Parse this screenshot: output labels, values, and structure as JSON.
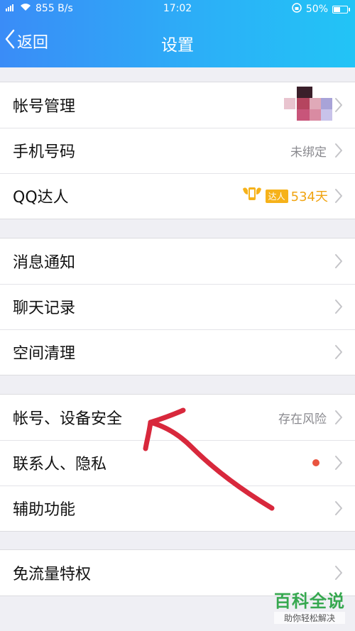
{
  "status_bar": {
    "network": "855 B/s",
    "time": "17:02",
    "battery": "50%",
    "battery_level": 0.5
  },
  "header": {
    "back_label": "返回",
    "title": "设置"
  },
  "groups": [
    {
      "items": [
        {
          "label": "帐号管理",
          "value": ""
        },
        {
          "label": "手机号码",
          "value": "未绑定"
        },
        {
          "label": "QQ达人",
          "badge_tag": "达人",
          "badge_days": "534天"
        }
      ]
    },
    {
      "items": [
        {
          "label": "消息通知"
        },
        {
          "label": "聊天记录"
        },
        {
          "label": "空间清理"
        }
      ]
    },
    {
      "items": [
        {
          "label": "帐号、设备安全",
          "value": "存在风险"
        },
        {
          "label": "联系人、隐私"
        },
        {
          "label": "辅助功能"
        }
      ]
    },
    {
      "items": [
        {
          "label": "免流量特权"
        }
      ]
    }
  ],
  "colors": {
    "header_start": "#3a8cf7",
    "header_end": "#22c4f6",
    "annotation_arrow": "#d8283c",
    "red_dot": "#e9543f",
    "badge": "#f6b21a"
  },
  "watermark": {
    "main": "百科全说",
    "sub": "助你轻松解决"
  }
}
